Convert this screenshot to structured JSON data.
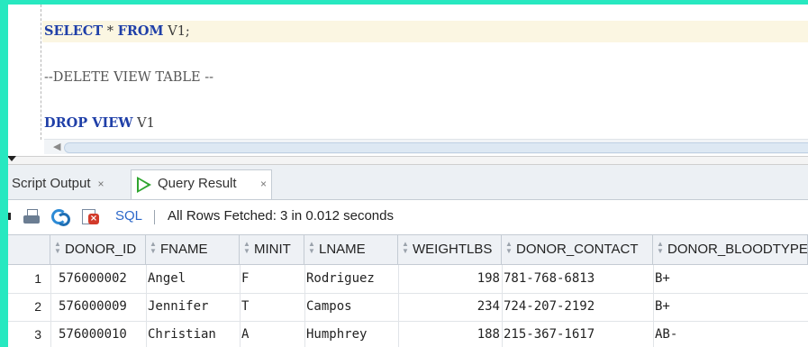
{
  "editor": {
    "lines": [
      {
        "kw1": "SELECT",
        "mid": " * ",
        "kw2": "FROM",
        "rest": " V1;"
      },
      {
        "comment": "--DELETE VIEW TABLE --"
      },
      {
        "kw1": "DROP VIEW",
        "rest": " V1"
      }
    ]
  },
  "tabs": [
    {
      "label": "Script Output",
      "close": "×"
    },
    {
      "label": "Query Result",
      "close": "×"
    }
  ],
  "toolbar": {
    "sql_label": "SQL",
    "separator": "|",
    "status": "All Rows Fetched: 3 in 0.012 seconds"
  },
  "grid": {
    "columns": [
      "DONOR_ID",
      "FNAME",
      "MINIT",
      "LNAME",
      "WEIGHTLBS",
      "DONOR_CONTACT",
      "DONOR_BLOODTYPE"
    ],
    "rows": [
      {
        "num": "1",
        "cells": [
          "576000002",
          "Angel",
          "F",
          "Rodriguez",
          "198",
          "781-768-6813",
          "B+"
        ]
      },
      {
        "num": "2",
        "cells": [
          "576000009",
          "Jennifer",
          "T",
          "Campos",
          "234",
          "724-207-2192",
          "B+"
        ]
      },
      {
        "num": "3",
        "cells": [
          "576000010",
          "Christian",
          "A",
          "Humphrey",
          "188",
          "215-367-1617",
          "AB-"
        ]
      }
    ]
  },
  "colors": {
    "frame": "#27e8c0",
    "keyword": "#1f3fa8",
    "highlight_line": "#fbf6e2",
    "run_icon": "#2fa52f",
    "sql_link": "#2b67c9"
  },
  "icons": [
    "print-icon",
    "refresh-icon",
    "delete-icon",
    "run-query-icon"
  ]
}
